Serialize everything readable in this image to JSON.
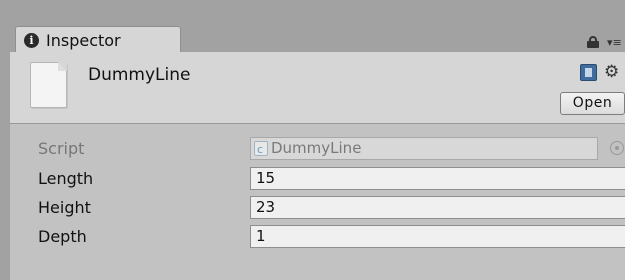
{
  "tab": {
    "title": "Inspector",
    "icon": "info-icon"
  },
  "header": {
    "asset_name": "DummyLine",
    "open_label": "Open",
    "icons": [
      "file-icon",
      "book-icon",
      "gear-icon",
      "lock-icon",
      "menu-icon"
    ]
  },
  "fields": {
    "script": {
      "label": "Script",
      "value": "DummyLine"
    },
    "length": {
      "label": "Length",
      "value": "15"
    },
    "height": {
      "label": "Height",
      "value": "23"
    },
    "depth": {
      "label": "Depth",
      "value": "1"
    }
  },
  "menu_glyph": "▾≡"
}
